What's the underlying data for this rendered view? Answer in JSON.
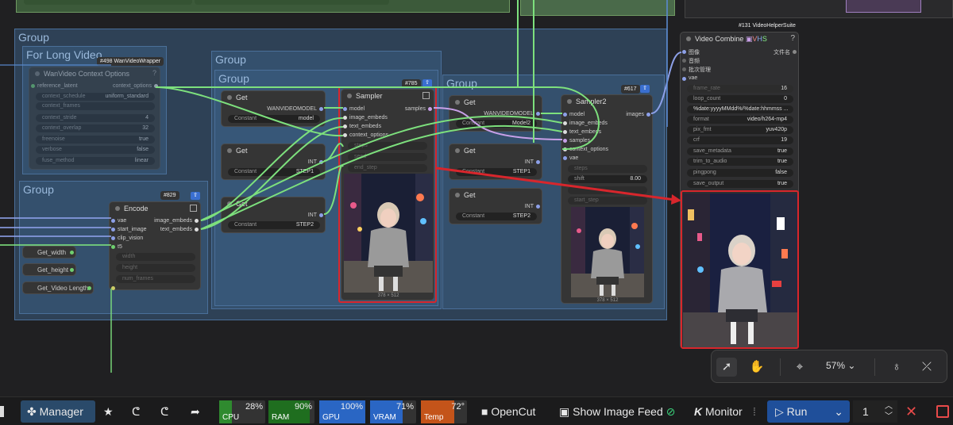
{
  "groups": {
    "outer": "Group",
    "long_video": "For Long Video",
    "encode_group": "Group",
    "sampler_group_1": "Group",
    "sampler_group_2": "Group",
    "sampler_group_3": "Group"
  },
  "context_options_node": {
    "badge": "#498 WanVideoWrapper",
    "title": "WanVideo Context Options",
    "input": "reference_latent",
    "output": "context_options",
    "widgets": [
      {
        "label": "context_schedule",
        "value": "uniform_standard"
      },
      {
        "label": "context_frames",
        "value": ""
      },
      {
        "label": "context_stride",
        "value": "4"
      },
      {
        "label": "context_overlap",
        "value": "32"
      },
      {
        "label": "freenoise",
        "value": "true"
      },
      {
        "label": "verbose",
        "value": "false"
      },
      {
        "label": "fuse_method",
        "value": "linear"
      }
    ]
  },
  "encode_node": {
    "badge": "#829",
    "title": "Encode",
    "inputs": [
      "vae",
      "start_image",
      "clip_vision",
      "t5"
    ],
    "outputs": [
      "image_embeds",
      "text_embeds"
    ],
    "widgets": [
      "width",
      "height",
      "num_frames"
    ]
  },
  "get_nodes_left": [
    "Get_width",
    "Get_height",
    "Get_Video Length"
  ],
  "get_nodes_mid": [
    {
      "title": "Get",
      "output": "WANVIDEOMODEL",
      "label": "Constant",
      "value": "model"
    },
    {
      "title": "Get",
      "output": "INT",
      "label": "Constant",
      "value": "STEP1"
    },
    {
      "title": "Get",
      "output": "INT",
      "label": "Constant",
      "value": "STEP2"
    }
  ],
  "sampler1": {
    "badge": "#785",
    "title": "Sampler",
    "inputs": [
      "model",
      "image_embeds",
      "text_embeds",
      "context_options"
    ],
    "output": "samples",
    "widgets": [
      "steps",
      "seed",
      "end_step"
    ],
    "size": "378 × 512"
  },
  "get_nodes_right": [
    {
      "title": "Get",
      "output": "WANVIDEOMODEL",
      "label": "Constant",
      "value": "Model2"
    },
    {
      "title": "Get",
      "output": "INT",
      "label": "Constant",
      "value": "STEP1"
    },
    {
      "title": "Get",
      "output": "INT",
      "label": "Constant",
      "value": "STEP2"
    }
  ],
  "sampler2": {
    "badge": "#617",
    "title": "Sampler2",
    "inputs": [
      "model",
      "image_embeds",
      "text_embeds",
      "samples",
      "context_options",
      "vae"
    ],
    "output": "images",
    "widgets": [
      {
        "label": "steps",
        "value": ""
      },
      {
        "label": "shift",
        "value": "8.00"
      },
      {
        "label": "",
        "value": ""
      },
      {
        "label": "start_step",
        "value": ""
      }
    ],
    "size": "378 × 512"
  },
  "video_combine": {
    "badge": "#131 VideoHelperSuite",
    "title": "Video Combine",
    "help": "?",
    "inputs": [
      "图像",
      "音频",
      "批次管理",
      "vae"
    ],
    "output_label": "文件名",
    "widgets": [
      {
        "label": "frame_rate",
        "value": "16"
      },
      {
        "label": "loop_count",
        "value": "0"
      },
      {
        "label": "",
        "value": "%date:yyyyMMdd%/%date:hhmmss ..."
      },
      {
        "label": "format",
        "value": "video/h264-mp4"
      },
      {
        "label": "pix_fmt",
        "value": "yuv420p"
      },
      {
        "label": "crf",
        "value": "19"
      },
      {
        "label": "save_metadata",
        "value": "true"
      },
      {
        "label": "trim_to_audio",
        "value": "true"
      },
      {
        "label": "pingpong",
        "value": "false"
      },
      {
        "label": "save_output",
        "value": "true"
      }
    ]
  },
  "controls": {
    "zoom": "57%"
  },
  "taskbar": {
    "manager": "Manager",
    "meters": [
      {
        "label": "CPU",
        "value": "28%",
        "fill": 0.28,
        "color": "#2f8a2f"
      },
      {
        "label": "RAM",
        "value": "90%",
        "fill": 0.9,
        "color": "#1f6e1f"
      },
      {
        "label": "GPU",
        "value": "100%",
        "fill": 1.0,
        "color": "#2a66c4"
      },
      {
        "label": "VRAM",
        "value": "71%",
        "fill": 0.71,
        "color": "#2a66c4"
      },
      {
        "label": "Temp",
        "value": "72°",
        "fill": 0.72,
        "color": "#c4541a"
      }
    ],
    "opencut": "OpenCut",
    "image_feed": "Show Image Feed",
    "monitor": "Monitor",
    "run": "Run",
    "batch": "1"
  },
  "colors": {
    "accent_blue": "#2f6fd6",
    "highlight_red": "#d8262c",
    "link_green": "#7de07d"
  }
}
